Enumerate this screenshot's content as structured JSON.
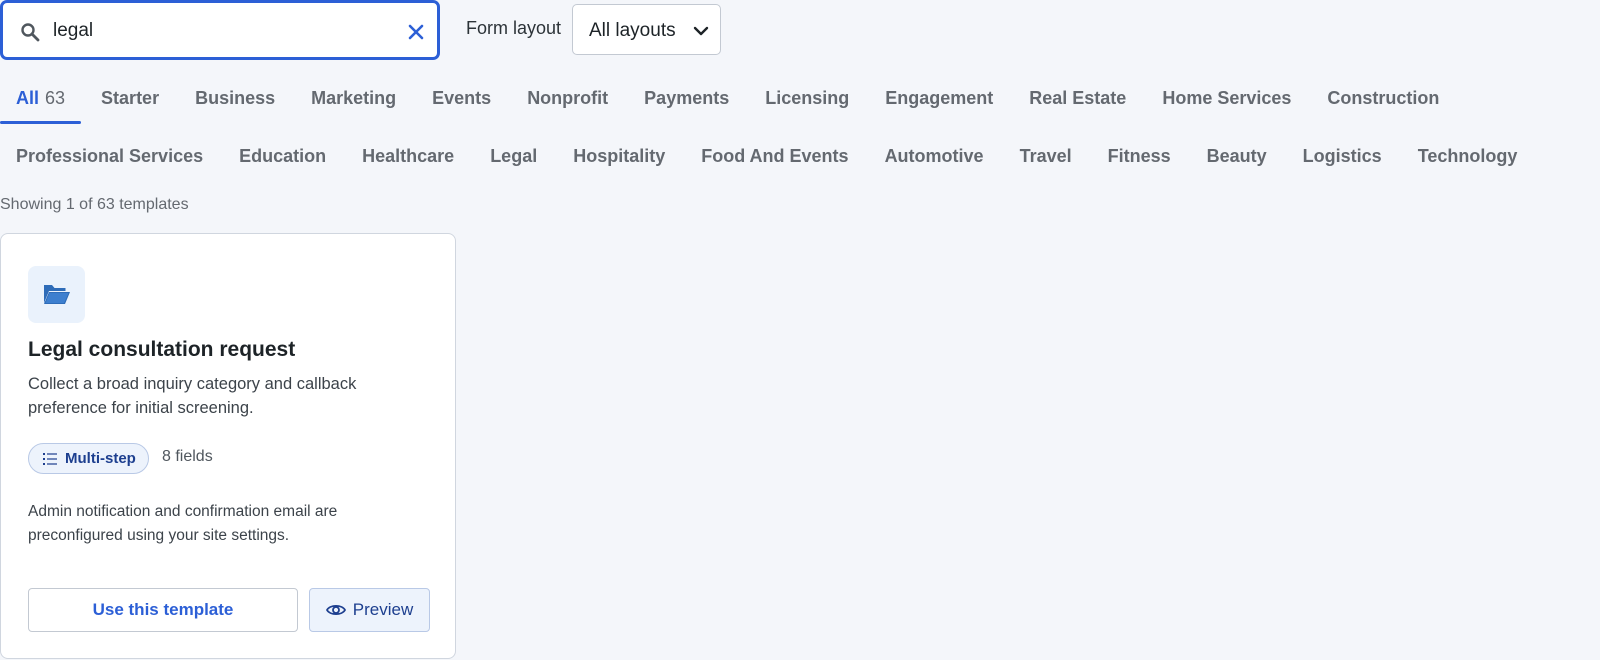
{
  "search": {
    "value": "legal",
    "placeholder": ""
  },
  "layout_filter": {
    "label": "Form layout",
    "selected": "All layouts"
  },
  "tabs_row1": [
    {
      "label": "All",
      "count": "63",
      "active": true
    },
    {
      "label": "Starter"
    },
    {
      "label": "Business"
    },
    {
      "label": "Marketing"
    },
    {
      "label": "Events"
    },
    {
      "label": "Nonprofit"
    },
    {
      "label": "Payments"
    },
    {
      "label": "Licensing"
    },
    {
      "label": "Engagement"
    },
    {
      "label": "Real Estate"
    },
    {
      "label": "Home Services"
    },
    {
      "label": "Construction"
    }
  ],
  "tabs_row2": [
    {
      "label": "Professional Services"
    },
    {
      "label": "Education"
    },
    {
      "label": "Healthcare"
    },
    {
      "label": "Legal"
    },
    {
      "label": "Hospitality"
    },
    {
      "label": "Food And Events"
    },
    {
      "label": "Automotive"
    },
    {
      "label": "Travel"
    },
    {
      "label": "Fitness"
    },
    {
      "label": "Beauty"
    },
    {
      "label": "Logistics"
    },
    {
      "label": "Technology"
    }
  ],
  "results": {
    "summary": "Showing 1 of 63 templates"
  },
  "card": {
    "icon": "folder-open-icon",
    "title": "Legal consultation request",
    "description": "Collect a broad inquiry category and callback preference for initial screening.",
    "badge": "Multi-step",
    "badge_icon": "list-icon",
    "fields": "8 fields",
    "note": "Admin notification and confirmation email are preconfigured using your site settings.",
    "use_label": "Use this template",
    "preview_label": "Preview",
    "preview_icon": "eye-icon"
  },
  "colors": {
    "accent": "#2c5fd6",
    "muted": "#646970",
    "background": "#f4f6fa",
    "badge_bg": "#edf3fc"
  }
}
